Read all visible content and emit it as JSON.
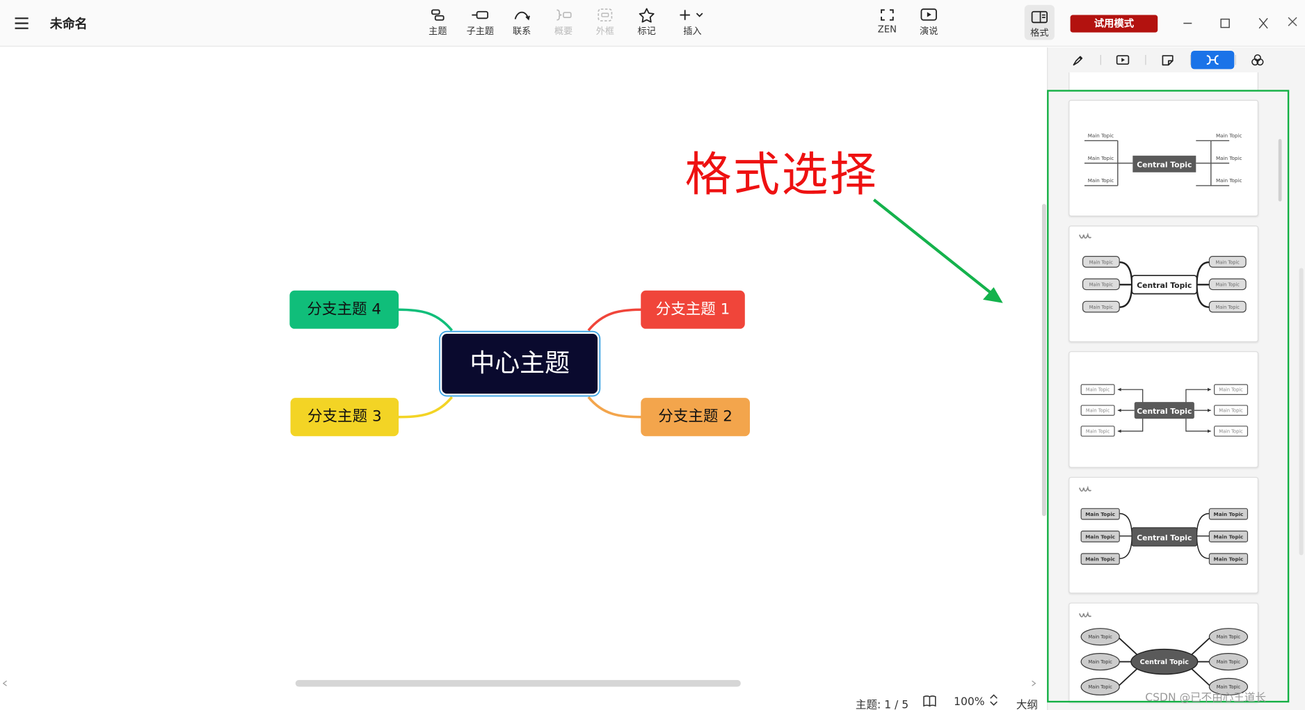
{
  "window": {
    "doc_title": "未命名"
  },
  "toolbar": {
    "tools": [
      {
        "label": "主题"
      },
      {
        "label": "子主题"
      },
      {
        "label": "联系"
      },
      {
        "label": "概要"
      },
      {
        "label": "外框"
      },
      {
        "label": "标记"
      },
      {
        "label": "插入"
      },
      {
        "label": "ZEN"
      },
      {
        "label": "演说"
      }
    ],
    "format_label": "格式",
    "trial_label": "试用模式"
  },
  "canvas": {
    "central_topic": "中心主题",
    "branches": [
      {
        "label": "分支主题 1",
        "color": "#f0453a"
      },
      {
        "label": "分支主题 2",
        "color": "#f3a54c"
      },
      {
        "label": "分支主题 3",
        "color": "#f3d425"
      },
      {
        "label": "分支主题 4",
        "color": "#10be7a"
      }
    ],
    "annotation": "格式选择",
    "annotation_color": "#ee1111",
    "arrow_color": "#14b24c"
  },
  "panel": {
    "tabs": [
      {
        "icon": "style-brush-icon"
      },
      {
        "icon": "pitch-slide-icon"
      },
      {
        "icon": "sticker-icon"
      },
      {
        "icon": "structure-icon",
        "active": true
      },
      {
        "icon": "theme-palette-icon"
      }
    ],
    "accent": "#1a73e8",
    "thumb_central_label": "Central Topic",
    "thumb_main_label": "Main Topic"
  },
  "status": {
    "topic_count": "主题: 1 / 5",
    "zoom": "100%",
    "outline_label": "大纲"
  },
  "watermark": "CSDN @已不由心王道长"
}
